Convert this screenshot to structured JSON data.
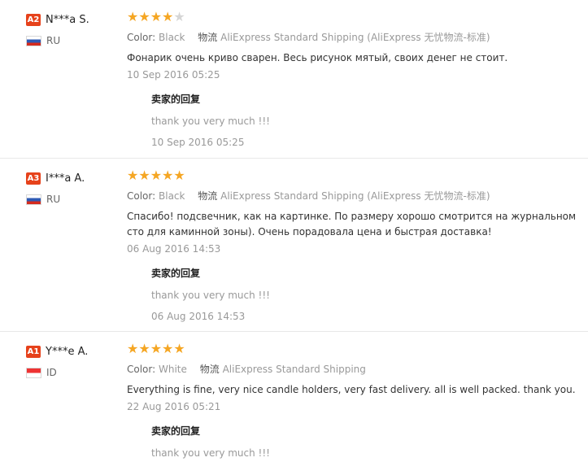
{
  "reviews": [
    {
      "badge": "A2",
      "name": "N***a S.",
      "country": "RU",
      "rating": 4,
      "stars_filled": "★★★★",
      "stars_empty": "★",
      "color_label": "Color:",
      "color_value": "Black",
      "shipping_label": "物流",
      "shipping_value": "AliExpress Standard Shipping (AliExpress 无忧物流-标准)",
      "text": "Фонарик очень криво сварен. Весь рисунок мятый, своих денег не стоит.",
      "date": "10 Sep 2016 05:25",
      "reply_title": "卖家的回复",
      "reply_text": "thank you very much !!!",
      "reply_date": "10 Sep 2016 05:25"
    },
    {
      "badge": "A3",
      "name": "I***a A.",
      "country": "RU",
      "rating": 5,
      "stars_filled": "★★★★★",
      "stars_empty": "",
      "color_label": "Color:",
      "color_value": "Black",
      "shipping_label": "物流",
      "shipping_value": "AliExpress Standard Shipping (AliExpress 无忧物流-标准)",
      "text": "Спасибо! подсвечник, как на картинке. По размеру хорошо смотрится на журнальном сто для каминной зоны). Очень порадовала цена и быстрая доставка!",
      "date": "06 Aug 2016 14:53",
      "reply_title": "卖家的回复",
      "reply_text": "thank you very much !!!",
      "reply_date": "06 Aug 2016 14:53"
    },
    {
      "badge": "A1",
      "name": "Y***e A.",
      "country": "ID",
      "rating": 5,
      "stars_filled": "★★★★★",
      "stars_empty": "",
      "color_label": "Color:",
      "color_value": "White",
      "shipping_label": "物流",
      "shipping_value": "AliExpress Standard Shipping",
      "text": "Everything is fine, very nice candle holders, very fast delivery. all is well packed. thank you.",
      "date": "22 Aug 2016 05:21",
      "reply_title": "卖家的回复",
      "reply_text": "thank you very much !!!",
      "reply_date": ""
    }
  ]
}
